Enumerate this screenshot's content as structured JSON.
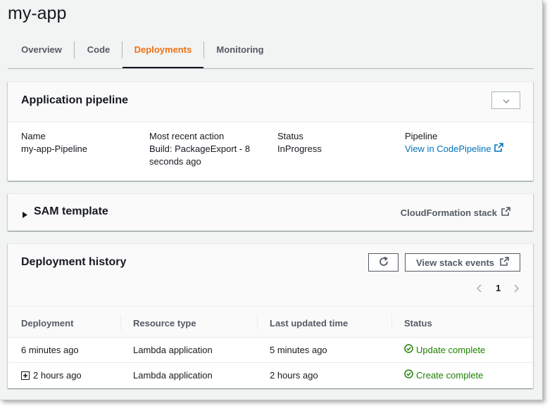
{
  "app": {
    "title": "my-app"
  },
  "tabs": [
    {
      "label": "Overview"
    },
    {
      "label": "Code"
    },
    {
      "label": "Deployments"
    },
    {
      "label": "Monitoring"
    }
  ],
  "active_tab": "Deployments",
  "pipeline": {
    "title": "Application pipeline",
    "name_label": "Name",
    "name_value": "my-app-Pipeline",
    "recent_label": "Most recent action",
    "recent_value": "Build: PackageExport - 8 seconds ago",
    "status_label": "Status",
    "status_value": "InProgress",
    "pipeline_label": "Pipeline",
    "pipeline_link": "View in CodePipeline"
  },
  "sam": {
    "title": "SAM template",
    "link": "CloudFormation stack"
  },
  "history": {
    "title": "Deployment history",
    "view_events_label": "View stack events",
    "page": "1",
    "columns": [
      "Deployment",
      "Resource type",
      "Last updated time",
      "Status"
    ],
    "rows": [
      {
        "deployment": "6 minutes ago",
        "resource_type": "Lambda application",
        "updated": "5 minutes ago",
        "status": "Update complete",
        "expandable": false
      },
      {
        "deployment": "2 hours ago",
        "resource_type": "Lambda application",
        "updated": "2 hours ago",
        "status": "Create complete",
        "expandable": true
      }
    ]
  },
  "colors": {
    "accent": "#ec7211",
    "link": "#0073bb",
    "success": "#1d8102"
  },
  "icons": [
    "chevron-down-icon",
    "external-link-icon",
    "caret-right-icon",
    "refresh-icon",
    "chevron-left-icon",
    "chevron-right-icon",
    "check-circle-icon",
    "expand-plus-icon"
  ]
}
